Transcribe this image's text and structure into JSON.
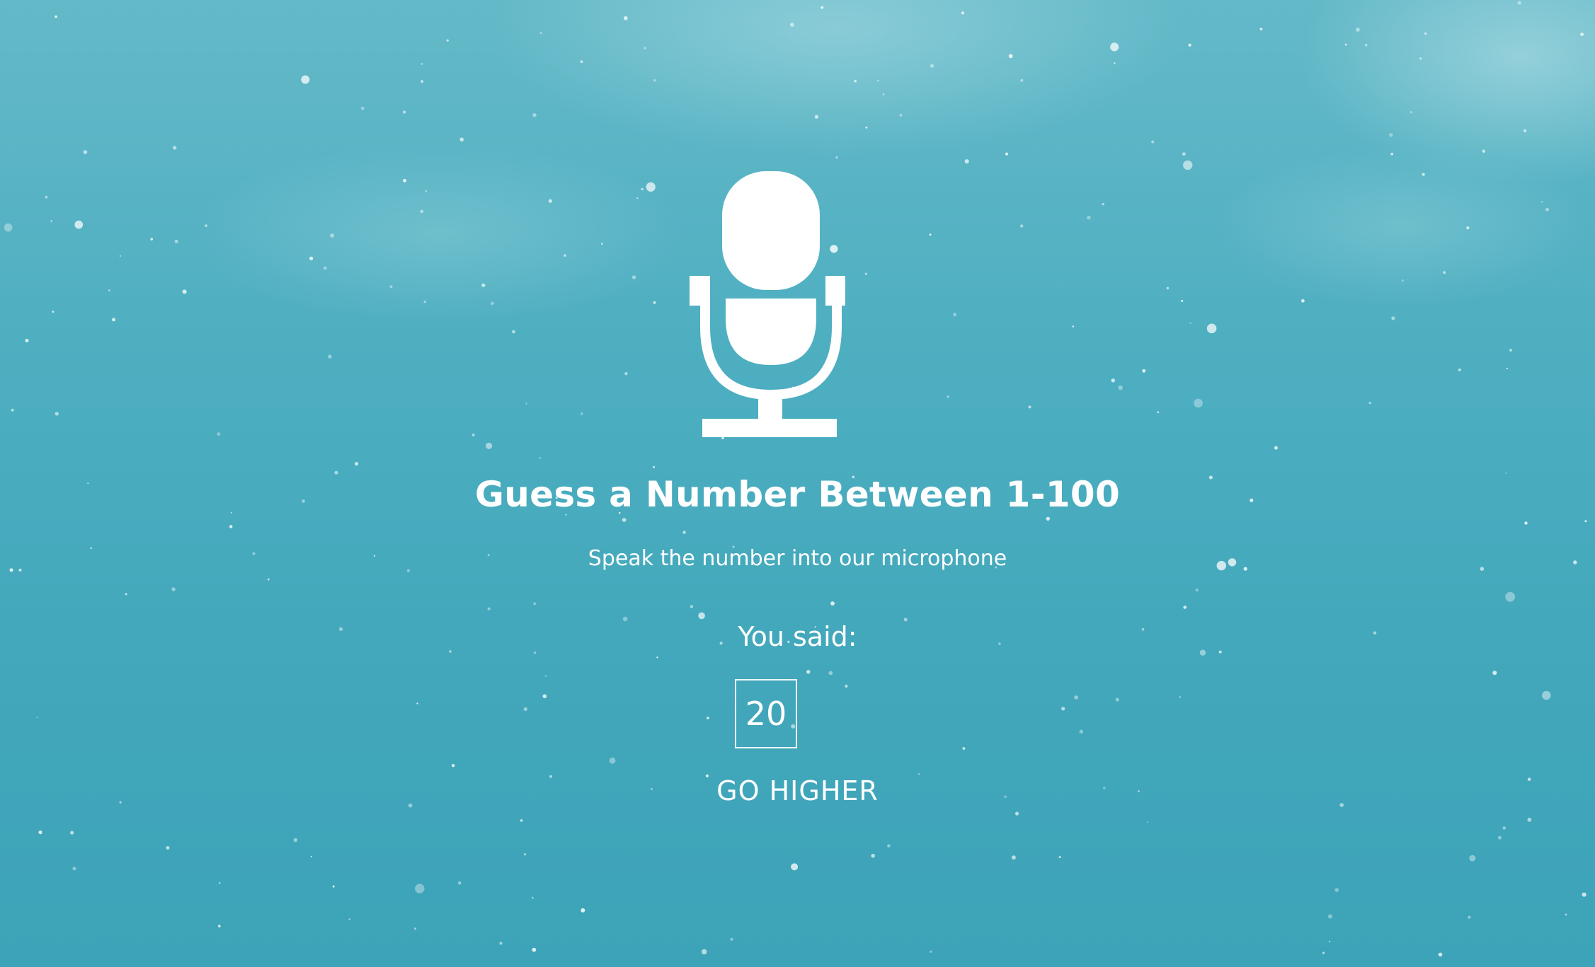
{
  "game": {
    "icon": "microphone-icon",
    "title": "Guess a Number Between 1-100",
    "subtitle": "Speak the number into our microphone",
    "said_label": "You said:",
    "guess_value": "20",
    "result_message": "GO HIGHER"
  },
  "colors": {
    "background": "#46a9bd",
    "text": "#ffffff"
  }
}
